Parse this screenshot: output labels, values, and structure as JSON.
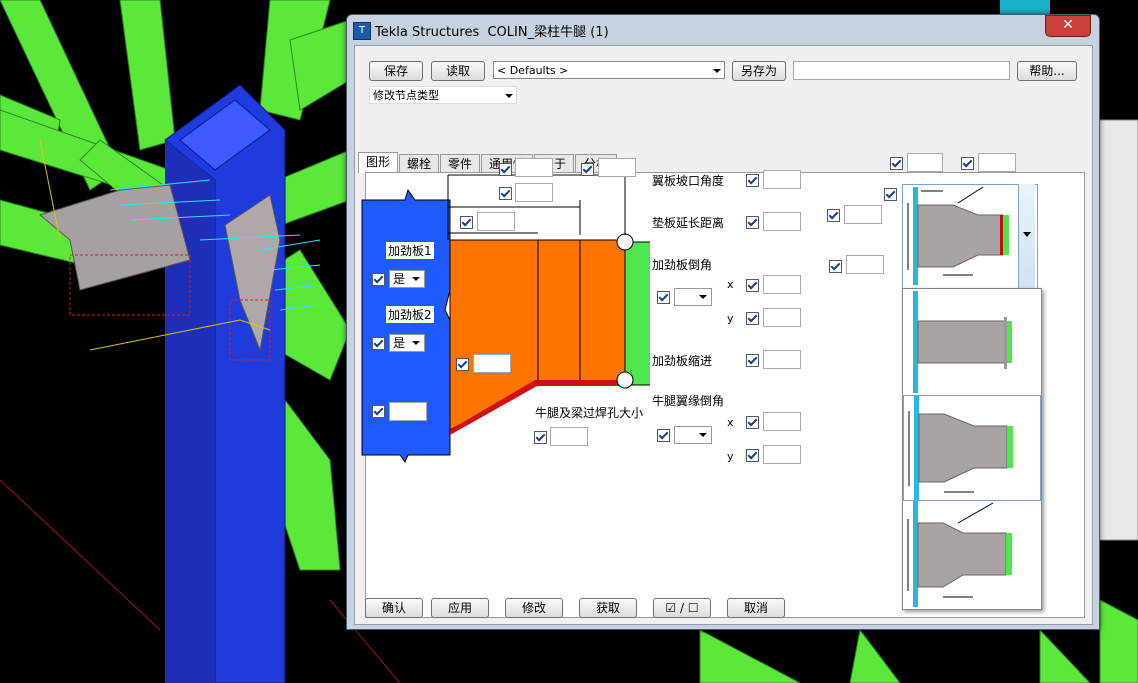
{
  "window": {
    "title": "Tekla Structures  COLIN_梁柱牛腿 (1)",
    "close": "✕",
    "app_icon": "tekla-icon"
  },
  "toolbar": {
    "save": "保存",
    "load": "读取",
    "preset": "< Defaults >",
    "save_as": "另存为",
    "save_as_name": "",
    "help": "帮助..."
  },
  "modify_type": "修改节点类型",
  "tabs": [
    "图形",
    "螺栓",
    "零件",
    "通用性",
    "关于",
    "分析"
  ],
  "labels": {
    "stiffener1": "加劲板1",
    "stiffener2": "加劲板2",
    "yes1": "是",
    "yes2": "是",
    "flange_bevel": "翼板坡口角度",
    "pad_extension": "垫板延长距离",
    "stiffener_chamfer": "加劲板倒角",
    "stiffener_inset": "加劲板缩进",
    "bracket_flange_chamfer": "牛腿翼缘倒角",
    "weld_hole": "牛腿及梁过焊孔大小",
    "x1": "x",
    "y1": "y",
    "x2": "x",
    "y2": "y"
  },
  "bottom": {
    "ok": "确认",
    "apply": "应用",
    "modify": "修改",
    "get": "获取",
    "toggle": "☑ / ☐",
    "cancel": "取消"
  },
  "colors": {
    "column": "#1e5aff",
    "bracket": "#ff7200",
    "beam": "#4ee84e",
    "weld": "#d01010",
    "dialog": "#c6d2e0"
  }
}
